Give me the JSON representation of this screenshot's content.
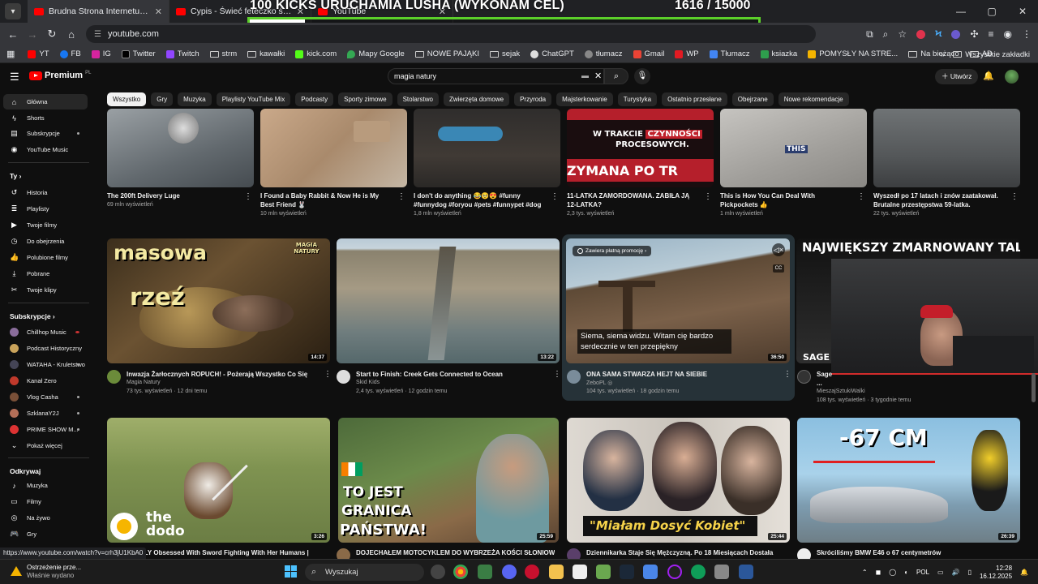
{
  "browser": {
    "tabs": [
      {
        "title": "Brudna Strona Internetu - YouTube",
        "close": "✕"
      },
      {
        "title": "Cypis - Świeć feteczko świeć",
        "close": "✕"
      },
      {
        "title": "YouTube",
        "close": "✕"
      }
    ],
    "url": "youtube.com",
    "window_controls": [
      "—",
      "▢",
      "✕"
    ],
    "bookmarks": [
      "YT",
      "FB",
      "IG",
      "Twitter",
      "Twitch",
      "strm",
      "kawałki",
      "kick.com",
      "Mapy Google",
      "NOWE PAJĄKI",
      "sejak",
      "ChatGPT",
      "tłumacz",
      "Gmail",
      "WP",
      "Tłumacz",
      "ksiazka",
      "POMYSŁY NA STRE...",
      "Na bieżąco",
      "AD"
    ],
    "bookmarks_more": "»",
    "all_bookmarks": "Wszystkie zakładki"
  },
  "overlay": {
    "goal_text": "100 KICKS URUCHAMIA LUSHA (WYKONAM CEL)",
    "count_text": "1616   / 15000",
    "progress_fraction": 0.1077
  },
  "youtube": {
    "logo_text": "Premium",
    "logo_region": "PL",
    "search_query": "magia natury",
    "create_label": "Utwórz",
    "chips": [
      "Wszystko",
      "Gry",
      "Muzyka",
      "Playlisty YouTube Mix",
      "Podcasty",
      "Sporty zimowe",
      "Stolarstwo",
      "Zwierzęta domowe",
      "Przyroda",
      "Majsterkowanie",
      "Turystyka",
      "Ostatnio przesłane",
      "Obejrzane",
      "Nowe rekomendacje"
    ],
    "sidebar": {
      "main": [
        "Główna",
        "Shorts",
        "Subskrypcje",
        "YouTube Music"
      ],
      "you_header": "Ty",
      "you": [
        "Historia",
        "Playlisty",
        "Twoje filmy",
        "Do obejrzenia",
        "Polubione filmy",
        "Pobrane",
        "Twoje klipy"
      ],
      "subs_header": "Subskrypcje",
      "subs": [
        "Chillhop Music",
        "Podcast Historyczny",
        "WATAHA - Kruletstwo",
        "Kanał Zero",
        "Vlog Casha",
        "SzklanaY2J",
        "PRIME SHOW M..."
      ],
      "show_more": "Pokaż więcej",
      "explore_header": "Odkrywaj",
      "explore": [
        "Muzyka",
        "Filmy",
        "Na żywo",
        "Gry"
      ]
    },
    "row1": [
      {
        "title": "The 200ft Delivery Luge",
        "meta": "69 mln wyświetleń"
      },
      {
        "title": "I Found a Baby Rabbit & Now He is My Best Friend 🐰",
        "meta": "10 mln wyświetleń"
      },
      {
        "title": "I don't do anything 😂🥺😍 #funny #funnydog #foryou #pets #funnypet #dog ...",
        "meta": "1,8 mln wyświetleń"
      },
      {
        "title": "11-LATKA ZAMORDOWANA. ZABIŁA JĄ 12-LATKA?",
        "meta": "2,3 tys. wyświetleń"
      },
      {
        "title": "This is How You Can Deal With Pickpockets 👍",
        "meta": "1 mln wyświetleń"
      },
      {
        "title": "Wyszedł po 17 latach i znów zaatakował. Brutalne przestępstwa 59-latka.",
        "meta": "22 tys. wyświetleń"
      }
    ],
    "row1_overlays": {
      "czyn_a": "W TRAKCIE",
      "czyn_b": "CZYNNOŚCI",
      "czyn_c": "PROCESOWYCH.",
      "czyn_d": "ZYMANA PO TR",
      "this": "THIS"
    },
    "row2": [
      {
        "title": "Inwazja Żarłocznych ROPUCH! - Pożerają Wszystko Co Się Rusza",
        "channel": "Magia Natury",
        "meta": "73 tys. wyświetleń · 12 dni temu",
        "duration": "14:37",
        "thumb_a": "masowa",
        "thumb_b": "rzeź",
        "thumb_c": "MAGIA NATURY"
      },
      {
        "title": "Start to Finish: Creek Gets Connected to Ocean",
        "channel": "Skid Kids",
        "meta": "2,4 tys. wyświetleń · 12 godzin temu",
        "duration": "13:22"
      },
      {
        "title": "ONA SAMA STWARZA HEJT NA SIEBIE",
        "channel": "ZeboPL ◎",
        "meta": "104 tys. wyświetleń · 18 godzin temu",
        "duration": "36:50",
        "promo": "Zawiera płatną promocję ›",
        "subtitle": "Siema, siema widzu. Witam cię bardzo serdecznie w ten przepiękny"
      },
      {
        "title": "Sage ... UFC\"",
        "channel": "MieszajSztukiWalki",
        "meta": "108 tys. wyświetleń · 3 tygodnie temu",
        "thumb_a": "NAJWIĘKSZY ZMARNOWANY TALENT",
        "thumb_b": "SAGE"
      }
    ],
    "row3": [
      {
        "title": "REALLY Obsessed With Sword Fighting With Her Humans |",
        "duration": "3:26",
        "thumb_a": "the",
        "thumb_b": "dodo"
      },
      {
        "title": "DOJECHAŁEM MOTOCYKLEM DO WYBRZEŻA KOŚCI SŁONIOWEJ!",
        "duration": "25:59",
        "thumb_a": "TO JEST",
        "thumb_b": "GRANICA",
        "thumb_c": "PAŃSTWA!"
      },
      {
        "title": "Dziennikarka Staje Się Mężczyzną. Po 18 Miesiącach Dostała",
        "duration": "25:44",
        "thumb_a": "\"Miałam Dosyć Kobiet\""
      },
      {
        "title": "Skróciliśmy BMW E46 o 67 centymetrów",
        "duration": "26:39",
        "thumb_a": "-67 CM"
      }
    ]
  },
  "status_url": "https://www.youtube.com/watch?v=crh3jU1KbA0",
  "taskbar": {
    "warning_title": "Ostrzeżenie prze...",
    "warning_sub": "Właśnie wydano",
    "search": "Wyszukaj",
    "lang": "POL",
    "time": "12:28",
    "date": "16.12.2025"
  }
}
